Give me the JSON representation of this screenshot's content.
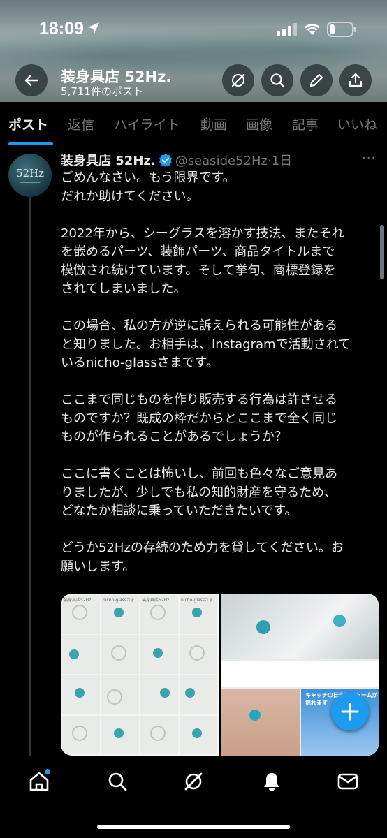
{
  "status_bar": {
    "time": "18:09"
  },
  "header": {
    "title": "装身具店 52Hz.",
    "post_count": "5,711件のポスト"
  },
  "tabs": [
    {
      "label": "ポスト",
      "active": true
    },
    {
      "label": "返信"
    },
    {
      "label": "ハイライト"
    },
    {
      "label": "動画"
    },
    {
      "label": "画像"
    },
    {
      "label": "記事"
    },
    {
      "label": "いいね"
    }
  ],
  "post": {
    "avatar_text": "52Hz",
    "author": "装身具店 52Hz.",
    "handle": "@seaside52Hz",
    "separator": "·",
    "time": "1日",
    "more": "···",
    "lines": [
      "ごめんなさい。もう限界です。",
      "だれか助けてください。",
      "",
      "2022年から、シーグラスを溶かす技法、またそれ",
      "を嵌めるパーツ、装飾パーツ、商品タイトルまで",
      "模倣され続けています。そして挙句、商標登録を",
      "されてしまいました。",
      "",
      "この場合、私の方が逆に訴えられる可能性がある",
      "と知りました。お相手は、Instagramで活動されて",
      "いるnicho-glassさまです。",
      "",
      "ここまで同じものを作り販売する行為は許させる",
      "ものですか？既成の枠だからとここまで全く同じ",
      "ものが作られることがあるでしょうか？",
      "",
      "ここに書くことは怖いし、前回も色々なご意見あ",
      "りましたが、少しでも私の知的財産を守るため、",
      "どなたか相談に乗っていただきたいです。",
      "",
      "どうか52Hzの存続のため力を貸してください。お",
      "願いします。"
    ],
    "media": {
      "left_labels": [
        "装身具店52Hz.",
        "nicho-glassさま",
        "装身具店52Hz.",
        "nicho-glassさま"
      ],
      "right_caption": "キャッチのほうにチャームが揺れます"
    }
  },
  "colors": {
    "accent": "#1d9bf0",
    "background": "#000000",
    "text": "#e7e9ea",
    "secondary_text": "#71767b"
  },
  "icons": {
    "back": "arrow-left-icon",
    "grok": "grok-icon",
    "search": "search-icon",
    "edit": "pencil-icon",
    "share": "share-icon",
    "fab": "plus-icon",
    "nav": [
      "home-icon",
      "search-icon",
      "grok-icon",
      "bell-icon",
      "mail-icon"
    ]
  }
}
